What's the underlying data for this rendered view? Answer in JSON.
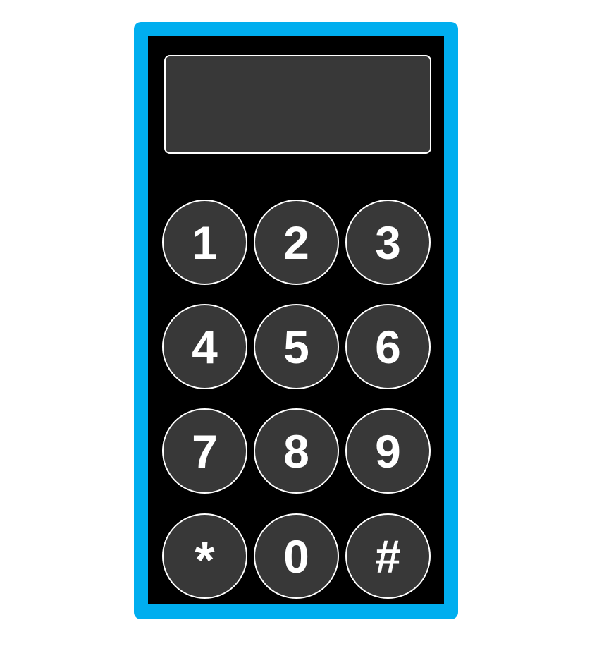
{
  "colors": {
    "frame": "#00aeef",
    "panel": "#000000",
    "key_fill": "#383838",
    "key_border": "#ffffff",
    "key_text": "#ffffff",
    "display_fill": "#383838"
  },
  "display": {
    "value": ""
  },
  "keypad": {
    "keys": [
      "1",
      "2",
      "3",
      "4",
      "5",
      "6",
      "7",
      "8",
      "9",
      "*",
      "0",
      "#"
    ]
  }
}
